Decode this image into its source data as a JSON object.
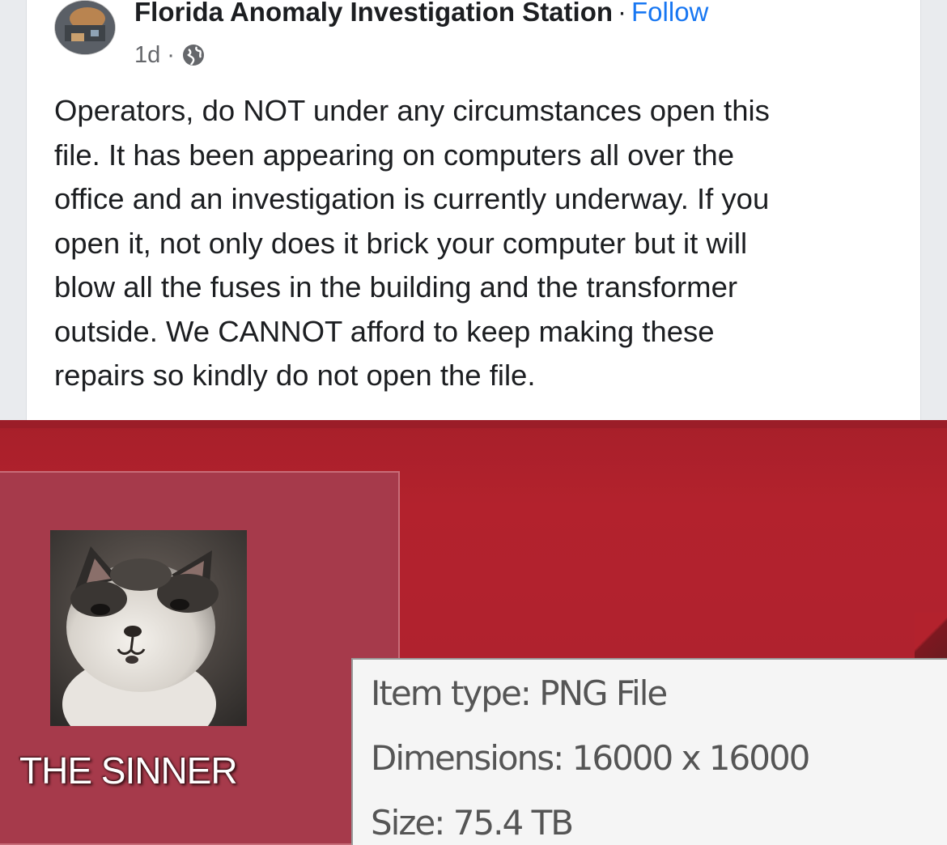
{
  "post": {
    "page_name": "Florida Anomaly Investigation Station",
    "separator": "·",
    "follow_label": "Follow",
    "time_ago": "1d",
    "meta_separator": "·",
    "privacy_icon": "globe-icon",
    "body": "Operators, do NOT under any circumstances open this\nfile. It has been appearing on computers all over the\noffice and an investigation is currently underway. If you\nopen it, not only does it brick your computer but it will\nblow all the fuses in the building and the transformer\noutside. We CANNOT afford to keep making these\nrepairs so kindly do not open the file."
  },
  "screenshot": {
    "file_name": "THE SINNER",
    "tooltip": {
      "item_type": "Item type: PNG File",
      "dimensions": "Dimensions: 16000 x 16000",
      "size": "Size: 75.4 TB"
    }
  },
  "colors": {
    "desktop_background": "#b3222d",
    "link": "#1877f2"
  }
}
